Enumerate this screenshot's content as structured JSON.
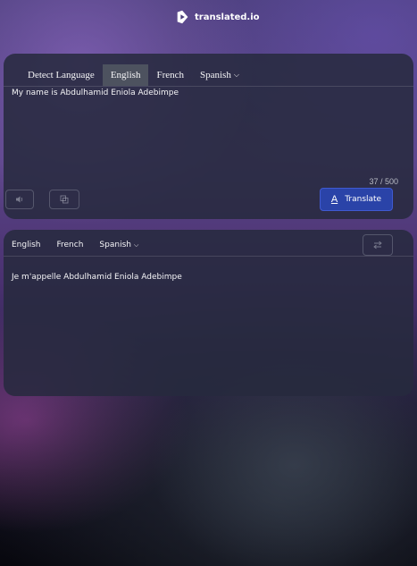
{
  "app": {
    "logo_text": "translated.io",
    "logo_icon": "translate-logo-icon"
  },
  "source": {
    "tabs": [
      {
        "label": "Detect Language",
        "active": false
      },
      {
        "label": "English",
        "active": true
      },
      {
        "label": "French",
        "active": false
      },
      {
        "label": "Spanish",
        "active": false,
        "dropdown": true
      }
    ],
    "text": "My name is Abdulhamid Eniola Adebimpe",
    "char_count": "37 / 500",
    "icons": [
      "speaker-icon",
      "copy-icon"
    ],
    "translate_label": "Translate",
    "translate_icon": "translate-icon"
  },
  "target": {
    "tabs": [
      {
        "label": "English",
        "active": false
      },
      {
        "label": "French",
        "active": true
      },
      {
        "label": "Spanish",
        "active": false,
        "dropdown": true
      }
    ],
    "text": "Je m'appelle Abdulhamid Eniola Adebimpe",
    "icons": [
      "swap-icon"
    ]
  },
  "colors": {
    "accent": "#2a43a8",
    "card_bg": "#262a3e",
    "active_tab": "#4d525f"
  }
}
